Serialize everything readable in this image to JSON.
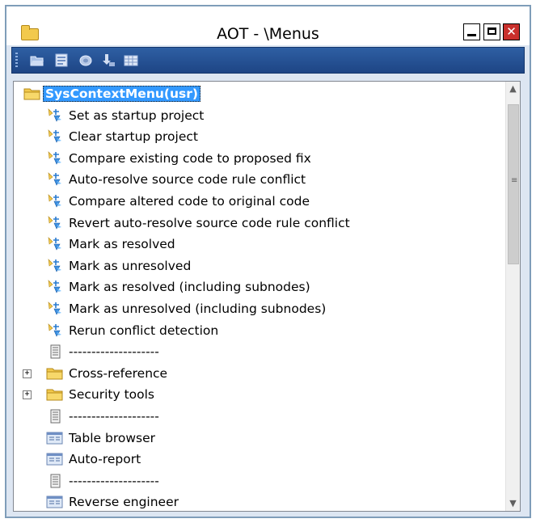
{
  "window": {
    "title": "AOT - \\Menus"
  },
  "toolbar": {
    "icons": [
      "open-icon",
      "properties-icon",
      "compile-icon",
      "import-icon",
      "grid-icon"
    ]
  },
  "tree": {
    "root": {
      "label": "SysContextMenu(usr)",
      "icon": "folder-icon"
    },
    "items": [
      {
        "label": "Set as startup project",
        "icon": "menu-item-action-icon"
      },
      {
        "label": "Clear startup project",
        "icon": "menu-item-action-icon"
      },
      {
        "label": "Compare existing code to proposed fix",
        "icon": "menu-item-action-icon"
      },
      {
        "label": "Auto-resolve source code rule conflict",
        "icon": "menu-item-action-icon"
      },
      {
        "label": "Compare altered code to original code",
        "icon": "menu-item-action-icon"
      },
      {
        "label": "Revert auto-resolve source code rule conflict",
        "icon": "menu-item-action-icon"
      },
      {
        "label": "Mark as resolved",
        "icon": "menu-item-action-icon"
      },
      {
        "label": "Mark as unresolved",
        "icon": "menu-item-action-icon"
      },
      {
        "label": "Mark as resolved (including subnodes)",
        "icon": "menu-item-action-icon"
      },
      {
        "label": "Mark as unresolved (including subnodes)",
        "icon": "menu-item-action-icon"
      },
      {
        "label": "Rerun conflict detection",
        "icon": "menu-item-action-icon"
      },
      {
        "label": "--------------------",
        "icon": "separator-icon"
      },
      {
        "label": "Cross-reference",
        "icon": "folder-icon",
        "expandable": "+"
      },
      {
        "label": "Security tools",
        "icon": "folder-icon",
        "expandable": "+"
      },
      {
        "label": "--------------------",
        "icon": "separator-icon"
      },
      {
        "label": "Table browser",
        "icon": "form-icon"
      },
      {
        "label": "Auto-report",
        "icon": "form-icon"
      },
      {
        "label": "--------------------",
        "icon": "separator-icon"
      },
      {
        "label": "Reverse engineer",
        "icon": "form-icon"
      }
    ]
  },
  "colors": {
    "selection": "#3399ff",
    "toolbar": "#2e5fa3",
    "close": "#c9302c"
  }
}
